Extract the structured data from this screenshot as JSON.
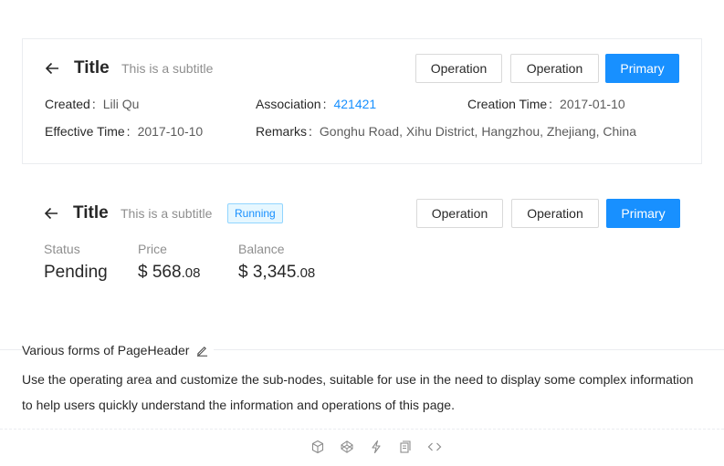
{
  "header1": {
    "title": "Title",
    "subtitle": "This is a subtitle",
    "buttons": [
      "Operation",
      "Operation",
      "Primary"
    ],
    "descriptions": [
      {
        "label": "Created",
        "value": "Lili Qu"
      },
      {
        "label": "Association",
        "value": "421421"
      },
      {
        "label": "Creation Time",
        "value": "2017-01-10"
      },
      {
        "label": "Effective Time",
        "value": "2017-10-10"
      },
      {
        "label": "Remarks",
        "value": "Gonghu Road, Xihu District, Hangzhou, Zhejiang, China"
      }
    ]
  },
  "header2": {
    "title": "Title",
    "subtitle": "This is a subtitle",
    "tag": "Running",
    "buttons": [
      "Operation",
      "Operation",
      "Primary"
    ],
    "stats": [
      {
        "label": "Status",
        "value": "Pending",
        "prefix": "",
        "int": "",
        "dec": ""
      },
      {
        "label": "Price",
        "value": "",
        "prefix": "$ ",
        "int": "568",
        "dec": ".08"
      },
      {
        "label": "Balance",
        "value": "",
        "prefix": "$ ",
        "int": "3,345",
        "dec": ".08"
      }
    ]
  },
  "demo": {
    "title": "Various forms of PageHeader",
    "description": "Use the operating area and customize the sub-nodes, suitable for use in the need to display some complex information to help users quickly understand the information and operations of this page.",
    "action_icons": [
      "codesandbox-icon",
      "codepen-icon",
      "thunderbolt-icon",
      "copy-icon",
      "code-icon"
    ]
  },
  "colors": {
    "primary": "#1890ff",
    "tag_bg": "#e6f7ff",
    "tag_border": "#91d5ff"
  }
}
